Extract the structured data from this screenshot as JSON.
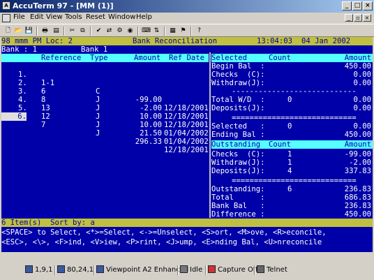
{
  "window": {
    "title": "AccuTerm 97 - [MM (1)]"
  },
  "menu": [
    "File",
    "Edit",
    "View",
    "Tools",
    "Reset",
    "Window",
    "Help"
  ],
  "terminal": {
    "header": {
      "left": "98 mmm PM Loc: 2",
      "title": "Bank Reconciliation",
      "time": "13:04:03",
      "date": "04 Jan 2002"
    },
    "bank_line": {
      "left": "Bank : 1",
      "right": "Bank 1"
    },
    "columns": {
      "reference": "Reference",
      "type": "Type",
      "amount": "Amount",
      "ref_date": "Ref Date"
    },
    "rows": [
      {
        "num": "1.",
        "ref": "1-1",
        "type": "C",
        "amount": "-99.00",
        "date": "12/18/2001"
      },
      {
        "num": "2.",
        "ref": "6",
        "type": "J",
        "amount": "-2.00",
        "date": "12/18/2001"
      },
      {
        "num": "3.",
        "ref": "8",
        "type": "J",
        "amount": "10.00",
        "date": "12/18/2001"
      },
      {
        "num": "4.",
        "ref": "13",
        "type": "J",
        "amount": "10.00",
        "date": "01/04/2002"
      },
      {
        "num": "5.",
        "ref": "12",
        "type": "J",
        "amount": "21.50",
        "date": "01/04/2002"
      },
      {
        "num": "6.",
        "ref": "7",
        "type": "J",
        "amount": "296.33",
        "date": "12/18/2001"
      }
    ],
    "selected_panel": {
      "header": {
        "label": "Selected",
        "count": "Count",
        "amount": "Amount"
      },
      "begin_bal": {
        "label": "Begin Bal  :",
        "amount": "450.00"
      },
      "checks": {
        "label": "Checks  (C):",
        "amount": "0.00"
      },
      "withdraw": {
        "label": "Withdraw(J):",
        "amount": "0.00"
      },
      "dash_rule": "----------------------------",
      "total_wd": {
        "label": "Total W/D  :",
        "count": "0",
        "amount": "0.00"
      },
      "deposits": {
        "label": "Deposits(J):",
        "amount": "0.00"
      },
      "double_rule": "============================",
      "selected": {
        "label": "Selected   :",
        "count": "0",
        "amount": "0.00"
      },
      "ending_bal": {
        "label": "Ending Bal :",
        "amount": "450.00"
      }
    },
    "outstanding_panel": {
      "header": {
        "label": "Outstanding",
        "count": "Count",
        "amount": "Amount"
      },
      "checks": {
        "label": "Checks  (C):",
        "count": "1",
        "amount": "-99.00"
      },
      "withdraw": {
        "label": "Withdraw(J):",
        "count": "1",
        "amount": "-2.00"
      },
      "deposits": {
        "label": "Deposits(J):",
        "count": "4",
        "amount": "337.83"
      },
      "double_rule": "============================",
      "outstanding": {
        "label": "Outstanding:",
        "count": "6",
        "amount": "236.83"
      },
      "total": {
        "label": "Total      :",
        "amount": "686.83"
      },
      "bank_bal": {
        "label": "Bank Bal   :",
        "amount": "236.83"
      },
      "difference": {
        "label": "Difference :",
        "amount": "450.00"
      }
    },
    "status": "6 Item(s)  Sort by: a",
    "help1": "<SPACE> to Select, <*>=Select, <->=Unselect, <S>ort, <M>ove, <R>econcile,",
    "help2": "<ESC>, <\\>, <F>ind, <V>iew, <P>rint, <J>ump, <E>nding Bal, <U>nreconcile"
  },
  "statusbar": [
    "1,9,1",
    "80,24,1",
    "Viewpoint A2 Enhanced",
    "Idle",
    "Capture Off",
    "Telnet"
  ]
}
